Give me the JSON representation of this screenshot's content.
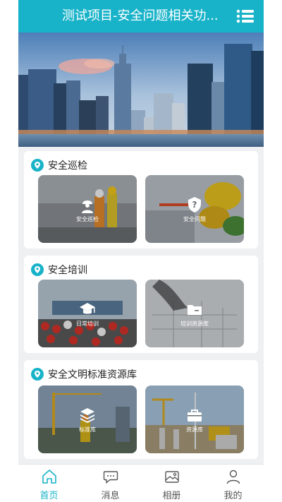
{
  "header": {
    "title": "测试项目-安全问题相关功..."
  },
  "sections": [
    {
      "title": "安全巡检",
      "cards": [
        {
          "label": "安全巡检",
          "icon": "worker-icon"
        },
        {
          "label": "安全问题",
          "icon": "shield-question-icon"
        }
      ]
    },
    {
      "title": "安全培训",
      "cards": [
        {
          "label": "日常培训",
          "icon": "graduation-cap-icon"
        },
        {
          "label": "培训资源库",
          "icon": "folder-icon"
        }
      ]
    },
    {
      "title": "安全文明标准资源库",
      "cards": [
        {
          "label": "标准库",
          "icon": "layers-icon"
        },
        {
          "label": "资源库",
          "icon": "toolbox-icon"
        }
      ]
    }
  ],
  "bottom_nav": [
    {
      "label": "首页",
      "icon": "home-icon",
      "active": true
    },
    {
      "label": "消息",
      "icon": "message-icon",
      "active": false
    },
    {
      "label": "相册",
      "icon": "album-icon",
      "active": false
    },
    {
      "label": "我的",
      "icon": "user-icon",
      "active": false
    }
  ],
  "colors": {
    "accent": "#19b3c9",
    "inactive": "#555555"
  }
}
